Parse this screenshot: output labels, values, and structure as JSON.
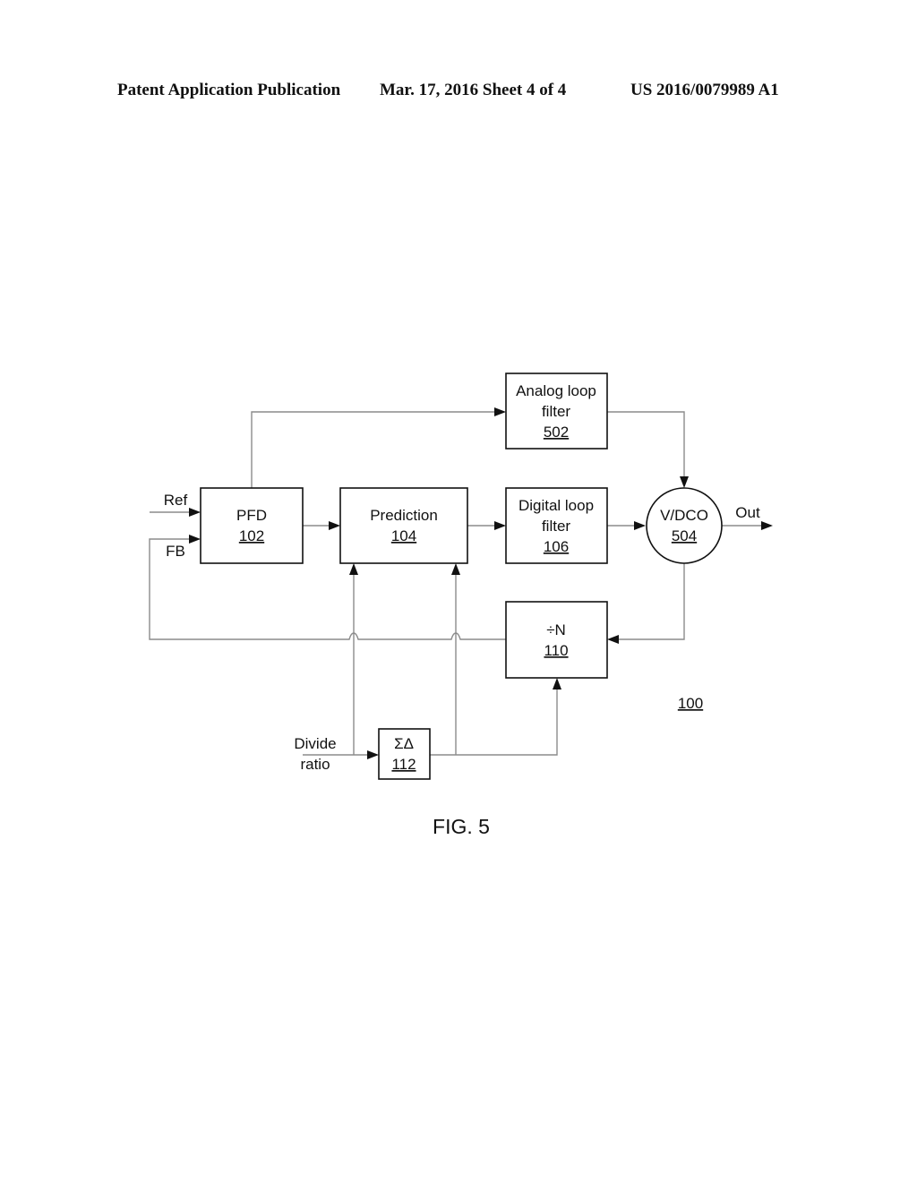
{
  "header": {
    "publication": "Patent Application Publication",
    "date_sheet": "Mar. 17, 2016  Sheet 4 of 4",
    "number": "US 2016/0079989 A1"
  },
  "blocks": {
    "pfd": {
      "name": "PFD",
      "ref": "102"
    },
    "prediction": {
      "name": "Prediction",
      "ref": "104"
    },
    "analog_filter": {
      "line1": "Analog loop",
      "line2": "filter",
      "ref": "502"
    },
    "digital_filter": {
      "line1": "Digital loop",
      "line2": "filter",
      "ref": "106"
    },
    "vdco": {
      "name": "V/DCO",
      "ref": "504"
    },
    "divider": {
      "name": "÷N",
      "ref": "110"
    },
    "sigma_delta": {
      "name": "ΣΔ",
      "ref": "112"
    }
  },
  "signals": {
    "ref": "Ref",
    "fb": "FB",
    "out": "Out",
    "divide_ratio_line1": "Divide",
    "divide_ratio_line2": "ratio"
  },
  "system_ref": "100",
  "figure_label": "FIG. 5"
}
